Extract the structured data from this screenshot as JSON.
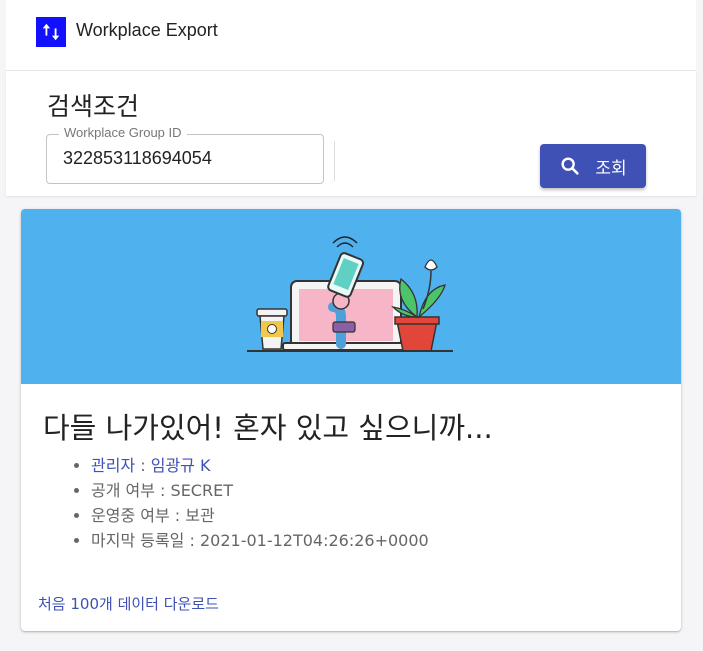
{
  "app": {
    "title": "Workplace Export",
    "logo_icon": "swap-vertical-icon",
    "logo_color": "#1111ff"
  },
  "search": {
    "section_title": "검색조건",
    "field_label": "Workplace Group ID",
    "field_value": "322853118694054",
    "button_label": "조회",
    "button_icon": "search-icon",
    "accent_color": "#3f51b5"
  },
  "card": {
    "title": "다들 나가있어! 혼자 있고 싶으니까...",
    "media_color": "#4fb2ef",
    "details": [
      {
        "key": "관리자",
        "sep": " : ",
        "value": "임광규 K"
      },
      {
        "key": "공개 여부",
        "sep": " : ",
        "value": "SECRET"
      },
      {
        "key": "운영중 여부",
        "sep": " : ",
        "value": "보관"
      },
      {
        "key": "마지막 등록일",
        "sep": " : ",
        "value": "2021-01-12T04:26:26+0000"
      }
    ],
    "action_label": "처음 100개 데이터 다운로드"
  }
}
